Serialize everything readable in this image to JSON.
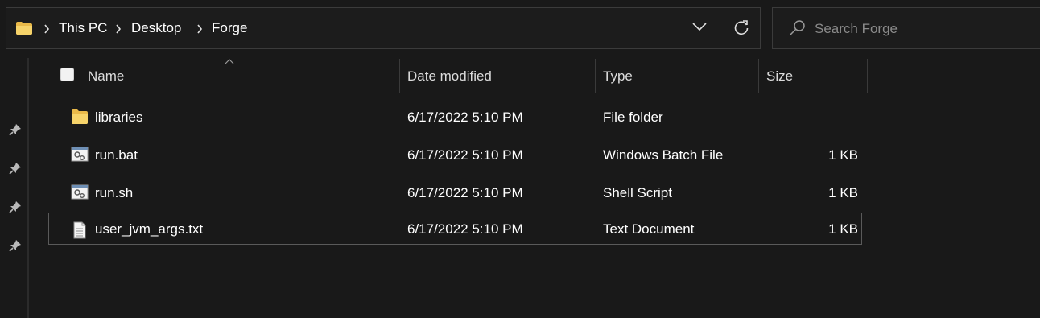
{
  "breadcrumb": {
    "items": [
      "This PC",
      "Desktop",
      "Forge"
    ]
  },
  "search": {
    "placeholder": "Search Forge"
  },
  "columns": {
    "name": "Name",
    "date": "Date modified",
    "type": "Type",
    "size": "Size"
  },
  "files": [
    {
      "name": "libraries",
      "date": "6/17/2022 5:10 PM",
      "type": "File folder",
      "size": "",
      "icon": "folder-icon"
    },
    {
      "name": "run.bat",
      "date": "6/17/2022 5:10 PM",
      "type": "Windows Batch File",
      "size": "1 KB",
      "icon": "batch-file-icon"
    },
    {
      "name": "run.sh",
      "date": "6/17/2022 5:10 PM",
      "type": "Shell Script",
      "size": "1 KB",
      "icon": "script-file-icon"
    },
    {
      "name": "user_jvm_args.txt",
      "date": "6/17/2022 5:10 PM",
      "type": "Text Document",
      "size": "1 KB",
      "icon": "text-file-icon"
    }
  ],
  "colors": {
    "background": "#191919",
    "folder": "#f2c94c",
    "border": "#3b3b3b"
  }
}
